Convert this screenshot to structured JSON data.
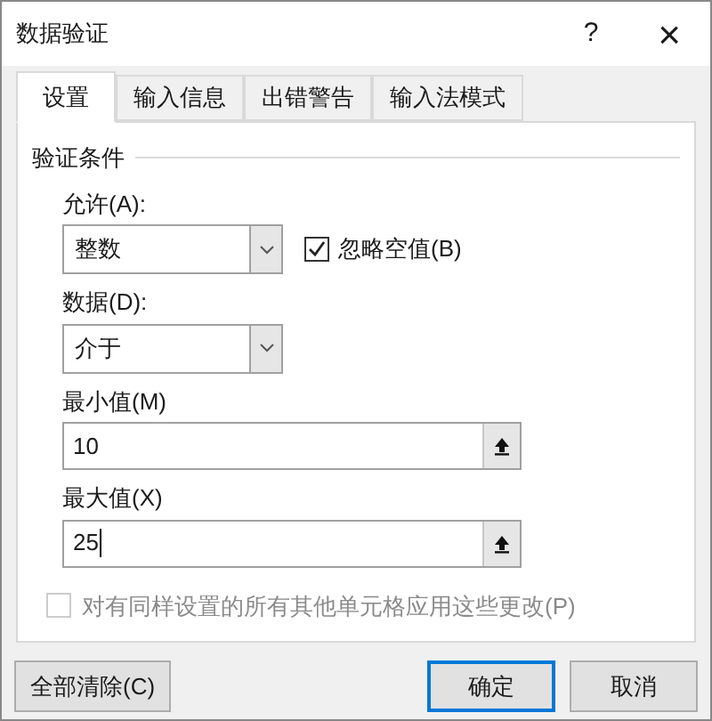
{
  "window": {
    "title": "数据验证",
    "help": "?",
    "close": "×"
  },
  "tabs": [
    {
      "label": "设置",
      "selected": true
    },
    {
      "label": "输入信息",
      "selected": false
    },
    {
      "label": "出错警告",
      "selected": false
    },
    {
      "label": "输入法模式",
      "selected": false
    }
  ],
  "group": {
    "title": "验证条件"
  },
  "allow": {
    "label": "允许(A):",
    "value": "整数"
  },
  "ignore_blank": {
    "label": "忽略空值(B)",
    "checked": true
  },
  "data": {
    "label": "数据(D):",
    "value": "介于"
  },
  "minimum": {
    "label": "最小值(M)",
    "value": "10"
  },
  "maximum": {
    "label": "最大值(X)",
    "value": "25"
  },
  "apply_all": {
    "label": "对有同样设置的所有其他单元格应用这些更改(P)",
    "checked": false,
    "disabled": true
  },
  "buttons": [
    {
      "label": "全部清除(C)",
      "default": false
    },
    {
      "label": "确定",
      "default": true
    },
    {
      "label": "取消",
      "default": false
    }
  ]
}
